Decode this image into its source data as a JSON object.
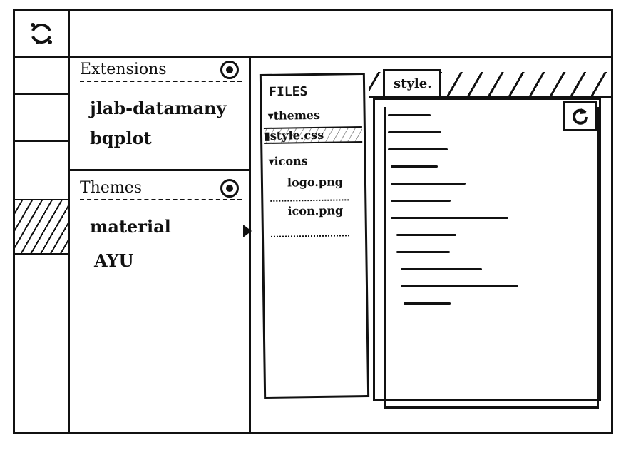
{
  "extensions": {
    "header": "Extensions",
    "items": [
      "jlab-datamany",
      "bqplot"
    ]
  },
  "themes": {
    "header": "Themes",
    "items": [
      "material",
      "AYU"
    ]
  },
  "files": {
    "title": "FILES",
    "tree": [
      "themes",
      "style.css",
      "icons",
      "logo.png",
      "icon.png"
    ]
  },
  "editor": {
    "tab_label": "style.",
    "code_lines": [
      0.2,
      0.25,
      0.28,
      0.22,
      0.35,
      0.28,
      0.55,
      0.28,
      0.25,
      0.38,
      0.55,
      0.22
    ]
  },
  "icons": {
    "app_logo": "jupyter-logo-icon",
    "add": "add-circle-icon",
    "refresh": "refresh-icon",
    "folder": "folder-caret-icon",
    "file": "file-icon",
    "collapse": "drag-handle-icon"
  }
}
